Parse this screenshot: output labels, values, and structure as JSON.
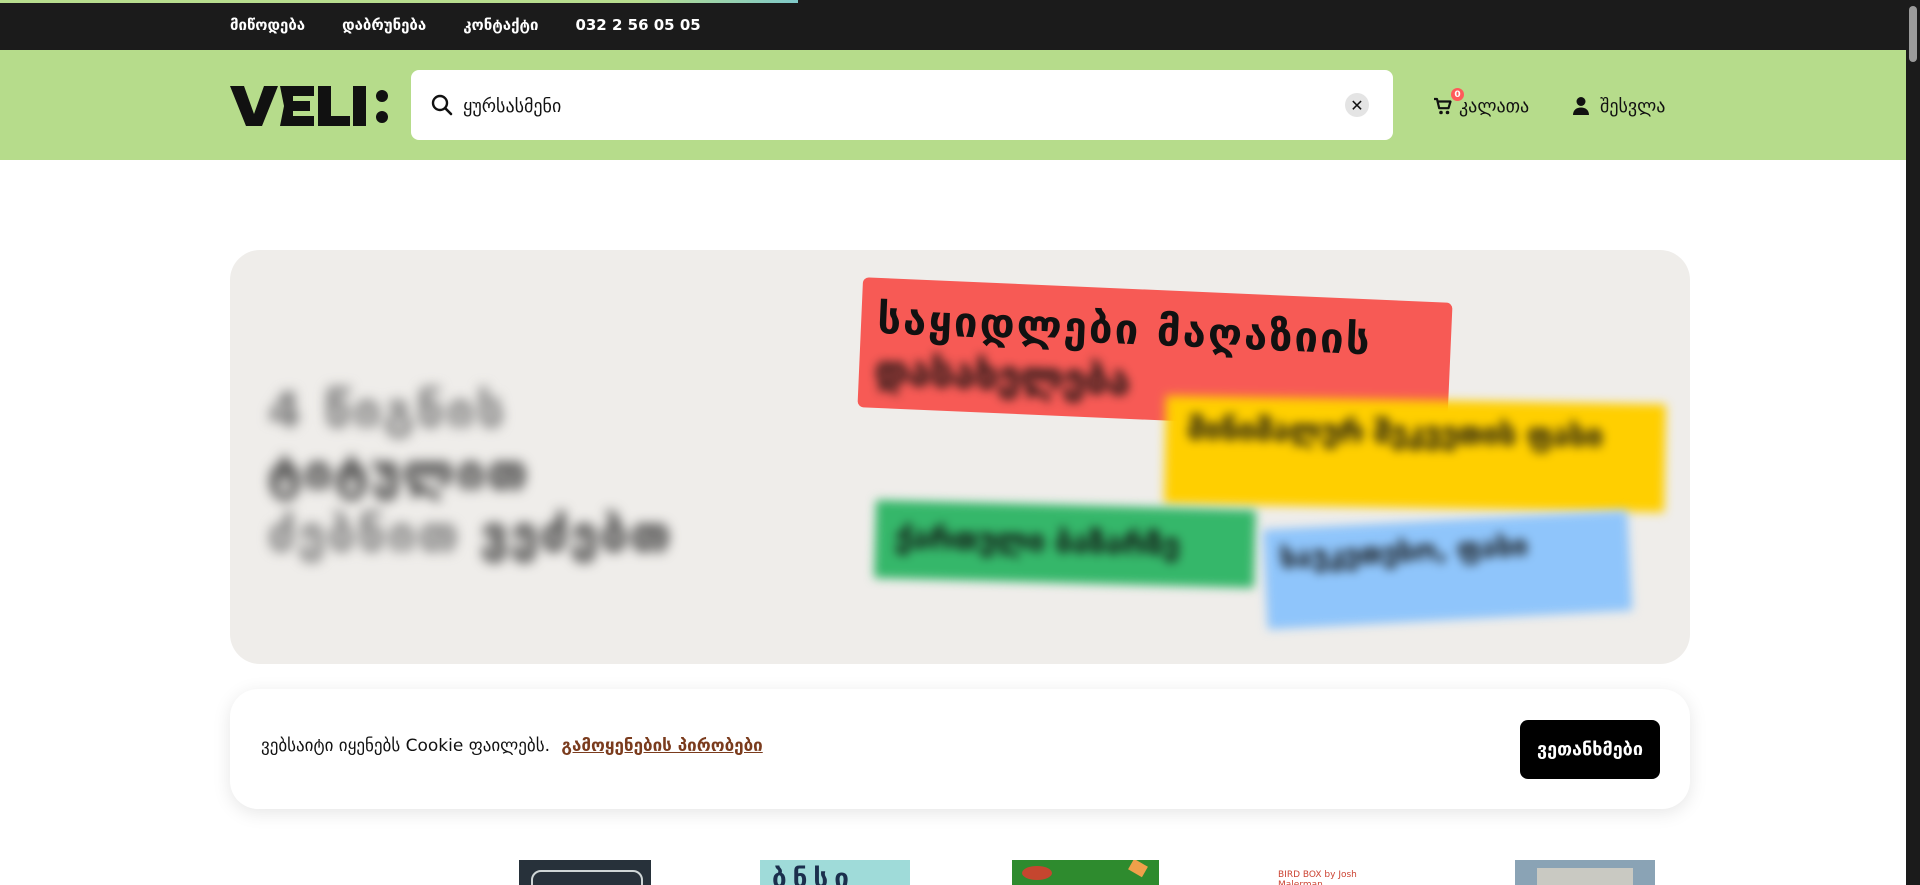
{
  "topbar": {
    "links": [
      "მიწოდება",
      "დაბრუნება",
      "კონტაქტი",
      "032 2 56 05 05"
    ]
  },
  "header": {
    "logo_text": "VELI:",
    "search": {
      "value": "ყურსასმენი",
      "placeholder": ""
    },
    "cart": {
      "label": "კალათა",
      "count": "0"
    },
    "login": {
      "label": "შესვლა"
    }
  },
  "banner": {
    "left_text_line1": "4 წიგნის",
    "left_text_line2": "ტიტულით",
    "left_text_line3": "ვეძებთ",
    "red_tag": "საყიდლები მაღაზიის",
    "red_tag_line2": "დასახელება",
    "yellow_tag": "მინიმალურ შეკვეთის ფასი",
    "green_tag": "ქართული ბაზარზე",
    "blue_tag": "საუკეთესო, ფასი"
  },
  "cookie": {
    "message": "ვებსაიტი იყენებს Cookie ფაილებს.",
    "link": "გამოყენების პირობები",
    "accept": "ვეთანხმები"
  },
  "books": {
    "b2_title": "ბნსი",
    "b4_title": "BIRD BOX by Josh Malerman"
  },
  "colors": {
    "header_bg": "#b6dc8b",
    "topbar_bg": "#1b1b1b",
    "banner_bg": "#efedea",
    "red_tag": "#f75a55",
    "yellow_tag": "#ffcf00",
    "green_tag": "#35b76a",
    "blue_tag": "#8fc5fb",
    "cookie_link": "#7a3b1d"
  }
}
